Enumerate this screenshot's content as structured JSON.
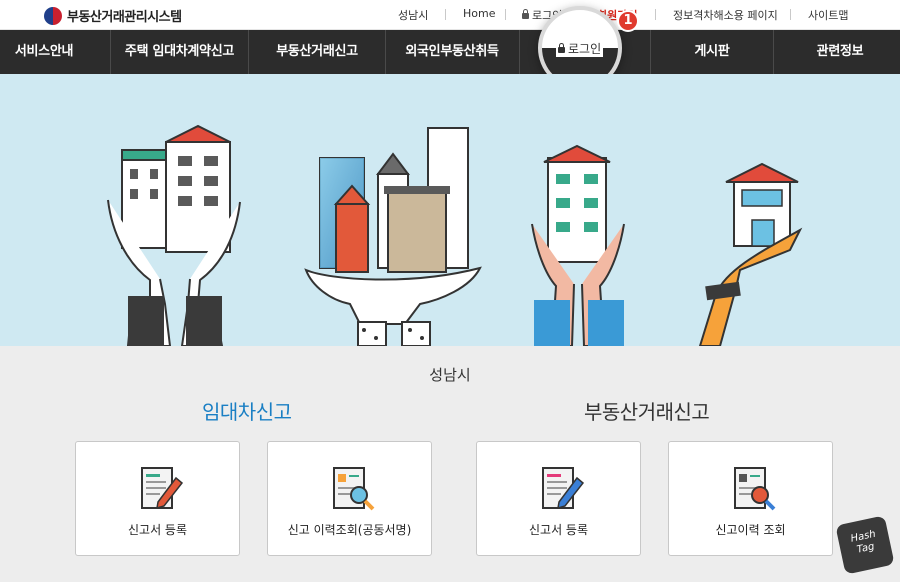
{
  "logo": {
    "text": "부동산거래관리시스템"
  },
  "utility": {
    "city": "성남시",
    "home": "Home",
    "login": "로그인",
    "signup": "회원가입",
    "info_access": "정보격차해소용 페이지",
    "sitemap": "사이트맵"
  },
  "nav": {
    "items": [
      "서비스안내",
      "주택 임대차계약신고",
      "부동산거래신고",
      "외국인부동산취득",
      "",
      "게시판",
      "관련정보"
    ]
  },
  "callout": {
    "text": "로그인",
    "badge": "1"
  },
  "main": {
    "city": "성남시",
    "rent_section": {
      "title": "임대차신고",
      "cards": [
        {
          "label": "신고서 등록",
          "icon": "document-pencil-icon"
        },
        {
          "label": "신고 이력조회(공동서명)",
          "icon": "document-search-icon"
        }
      ]
    },
    "trade_section": {
      "title": "부동산거래신고",
      "cards": [
        {
          "label": "신고서 등록",
          "icon": "document-pencil-icon"
        },
        {
          "label": "신고이력 조회",
          "icon": "document-search-icon"
        }
      ]
    }
  },
  "watermark": {
    "line1": "Hash",
    "line2": "Tag"
  },
  "colors": {
    "nav_bg": "#2c2c2c",
    "hero_bg": "#cfe9f2",
    "accent_blue": "#1a7fc4",
    "badge_red": "#e03a2e",
    "signup_red": "#d7261a"
  }
}
